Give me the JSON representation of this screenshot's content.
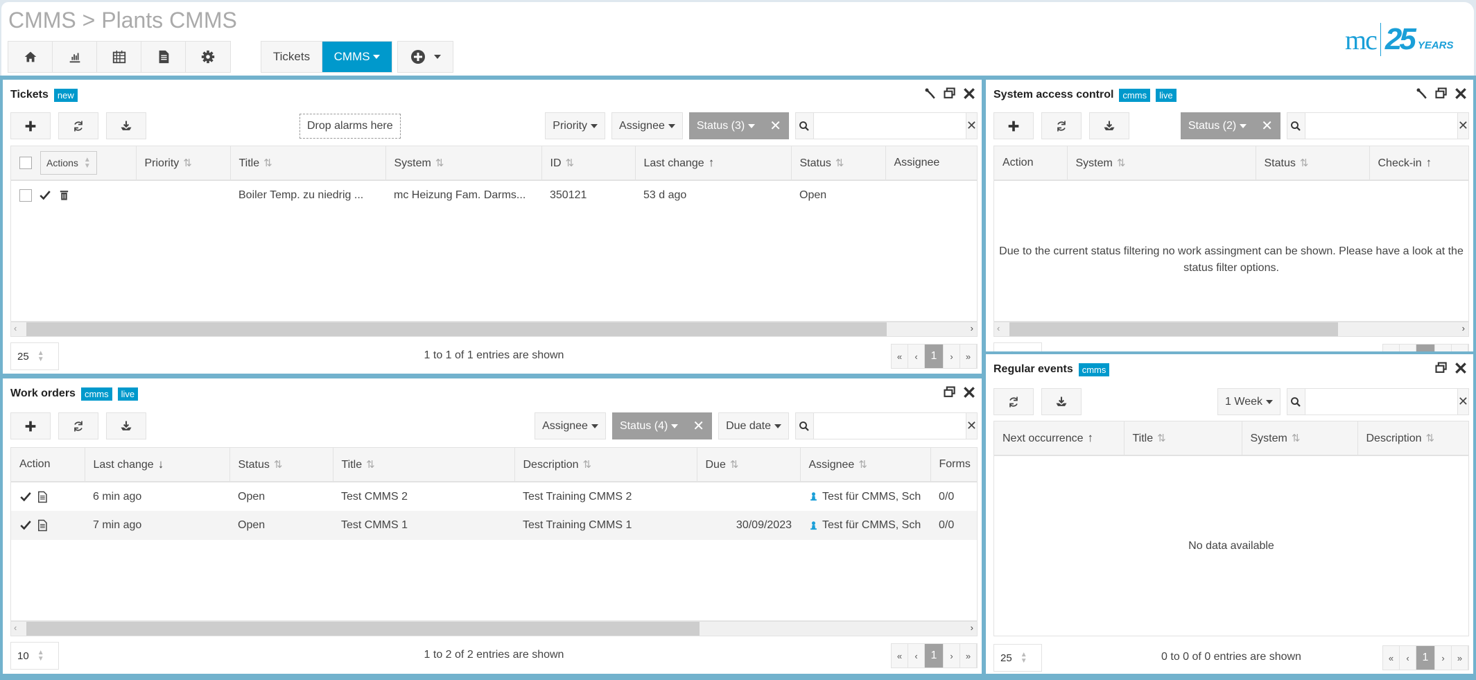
{
  "header": {
    "breadcrumb": "CMMS > Plants CMMS",
    "nav_icons": [
      "home-icon",
      "chart-icon",
      "calendar-icon",
      "document-icon",
      "gear-icon"
    ],
    "tabs": [
      {
        "label": "Tickets",
        "active": false
      },
      {
        "label": "CMMS",
        "active": true
      }
    ],
    "logo": {
      "mc": "mc",
      "number": "25",
      "years": "YEARS"
    }
  },
  "colors": {
    "accent": "#0099cc",
    "frame": "#72b2cd",
    "active_filter": "#9e9e9e"
  },
  "tickets": {
    "title": "Tickets",
    "badges": [
      "new"
    ],
    "drop_zone": "Drop alarms here",
    "filters": [
      {
        "label": "Priority"
      },
      {
        "label": "Assignee"
      },
      {
        "label": "Status (3)",
        "active": true
      }
    ],
    "columns": [
      {
        "label": "Actions",
        "sort": "select"
      },
      {
        "label": "Priority",
        "sort": "unsorted"
      },
      {
        "label": "Title",
        "sort": "unsorted"
      },
      {
        "label": "System",
        "sort": "unsorted"
      },
      {
        "label": "ID",
        "sort": "unsorted"
      },
      {
        "label": "Last change",
        "sort": "asc"
      },
      {
        "label": "Status",
        "sort": "unsorted"
      },
      {
        "label": "Assignee",
        "sort": "none"
      }
    ],
    "rows": [
      {
        "cells": [
          "",
          "",
          "Boiler Temp. zu niedrig ...",
          "mc Heizung Fam. Darms...",
          "350121",
          "53 d ago",
          "Open",
          ""
        ]
      }
    ],
    "scroll_visible_fraction": 0.92,
    "page_size": "25",
    "summary": "1 to 1 of 1 entries are shown",
    "page": "1"
  },
  "work_orders": {
    "title": "Work orders",
    "badges": [
      "cmms",
      "live"
    ],
    "filters": [
      {
        "label": "Assignee"
      },
      {
        "label": "Status (4)",
        "active": true
      },
      {
        "label": "Due date"
      }
    ],
    "columns": [
      {
        "label": "Action",
        "sort": "none"
      },
      {
        "label": "Last change",
        "sort": "desc"
      },
      {
        "label": "Status",
        "sort": "unsorted"
      },
      {
        "label": "Title",
        "sort": "unsorted"
      },
      {
        "label": "Description",
        "sort": "unsorted"
      },
      {
        "label": "Due",
        "sort": "unsorted"
      },
      {
        "label": "Assignee",
        "sort": "unsorted"
      },
      {
        "label": "Forms",
        "sort": "none"
      }
    ],
    "rows": [
      {
        "cells": [
          "",
          "6 min ago",
          "Open",
          "Test CMMS 2",
          "Test Training CMMS 2",
          "",
          "Test für CMMS, Sch",
          "0/0"
        ]
      },
      {
        "cells": [
          "",
          "7 min ago",
          "Open",
          "Test CMMS 1",
          "Test Training CMMS 1",
          "30/09/2023",
          "Test für CMMS, Sch",
          "0/0"
        ]
      }
    ],
    "scroll_visible_fraction": 0.72,
    "page_size": "10",
    "summary": "1 to 2 of 2 entries are shown",
    "page": "1"
  },
  "system_access": {
    "title": "System access control",
    "badges": [
      "cmms",
      "live"
    ],
    "filters": [
      {
        "label": "Status (2)",
        "active": true
      }
    ],
    "columns": [
      {
        "label": "Action",
        "sort": "none"
      },
      {
        "label": "System",
        "sort": "unsorted"
      },
      {
        "label": "Status",
        "sort": "unsorted"
      },
      {
        "label": "Check-in",
        "sort": "asc"
      }
    ],
    "rows": [],
    "empty_message": "Due to the current status filtering no work assingment can be shown. Please have a look at the status filter options.",
    "scroll_visible_fraction": 0.74,
    "page": "1"
  },
  "regular_events": {
    "title": "Regular events",
    "badges": [
      "cmms"
    ],
    "filters": [
      {
        "label": "1 Week"
      }
    ],
    "columns": [
      {
        "label": "Next occurrence",
        "sort": "asc"
      },
      {
        "label": "Title",
        "sort": "unsorted"
      },
      {
        "label": "System",
        "sort": "unsorted"
      },
      {
        "label": "Description",
        "sort": "unsorted"
      }
    ],
    "rows": [],
    "empty_message": "No data available",
    "page_size": "25",
    "summary": "0 to 0 of 0 entries are shown",
    "page": "1"
  },
  "pager": {
    "first": "«",
    "prev": "‹",
    "next": "›",
    "last": "»"
  }
}
